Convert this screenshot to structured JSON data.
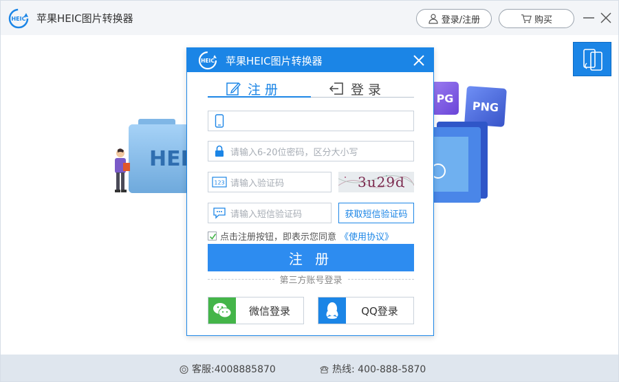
{
  "window": {
    "title": "苹果HEIC图片转换器",
    "logo_text": "HEIC",
    "login_register_label": "登录/注册",
    "buy_label": "购买"
  },
  "illustration": {
    "folder_text": "HEI",
    "format_cards": [
      "PG",
      "PNG"
    ]
  },
  "footer": {
    "service_label": "客服:4008885870",
    "hotline_label": "热线:  400-888-5870"
  },
  "modal": {
    "title": "苹果HEIC图片转换器",
    "logo_text": "HEIC",
    "tabs": [
      {
        "label": "注册",
        "active": true
      },
      {
        "label": "登录",
        "active": false
      }
    ],
    "fields": {
      "phone": {
        "value": "",
        "placeholder": ""
      },
      "password": {
        "value": "",
        "placeholder": "请输入6-20位密码，区分大小写"
      },
      "captcha": {
        "value": "",
        "placeholder": "请输入验证码"
      },
      "sms": {
        "value": "",
        "placeholder": "请输入短信验证码"
      }
    },
    "captcha_image_text": "3u29d",
    "sms_button_label": "获取短信验证码",
    "agreement": {
      "checked": true,
      "text": "点击注册按钮，即表示您同意",
      "link": "《使用协议》"
    },
    "submit_label": "注 册",
    "third_party_label": "第三方账号登录",
    "wechat_label": "微信登录",
    "qq_label": "QQ登录"
  },
  "colors": {
    "accent": "#1b85e6",
    "submit": "#2d8cf0",
    "wechat": "#44b549",
    "titlebar": "#f3f5f8",
    "footer": "#dfe6ee"
  }
}
